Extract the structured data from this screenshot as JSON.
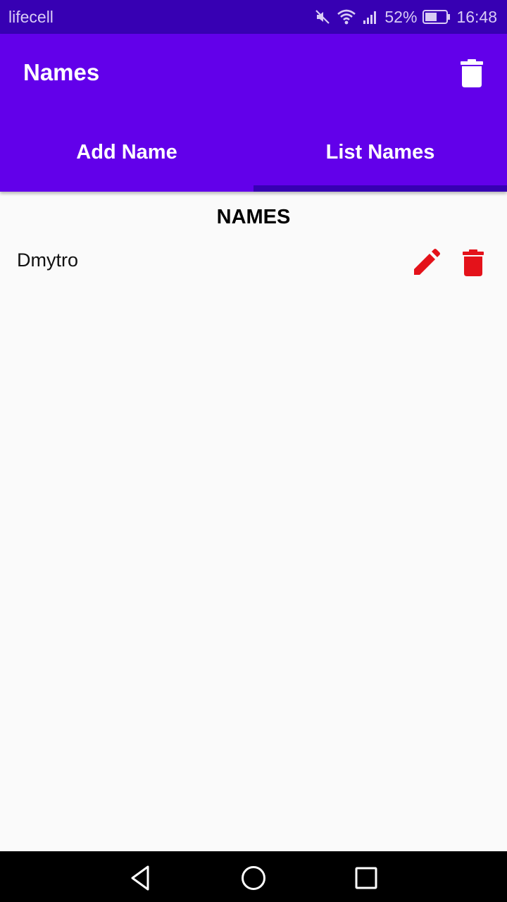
{
  "status_bar": {
    "carrier": "lifecell",
    "battery": "52%",
    "time": "16:48",
    "icons": [
      "mute-icon",
      "wifi-icon",
      "signal-icon",
      "battery-icon"
    ]
  },
  "toolbar": {
    "title": "Names",
    "action_icon": "trash-icon"
  },
  "tabs": [
    {
      "label": "Add Name",
      "selected": false
    },
    {
      "label": "List Names",
      "selected": true
    }
  ],
  "list": {
    "heading": "NAMES",
    "items": [
      {
        "name": "Dmytro",
        "actions": [
          "edit-icon",
          "trash-icon"
        ]
      }
    ]
  },
  "nav": {
    "buttons": [
      "back-icon",
      "home-icon",
      "recents-icon"
    ]
  },
  "colors": {
    "primary": "#6200ea",
    "primary_dark": "#3700b3",
    "action_red": "#e4121a",
    "background": "#fafafa"
  }
}
